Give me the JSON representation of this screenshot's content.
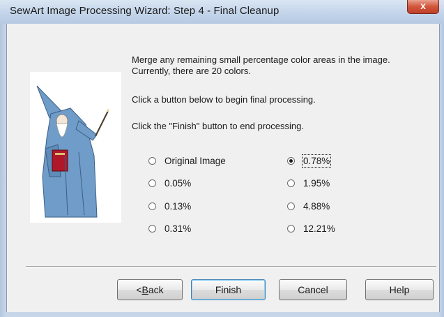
{
  "window": {
    "title": "SewArt Image Processing Wizard: Step 4 - Final Cleanup",
    "close_label": "x"
  },
  "instructions": {
    "line1": "Merge any remaining small percentage color  areas in the image. Currently, there are 20 colors.",
    "line2": "Click a button below to begin final processing.",
    "line3": "Click the \"Finish\" button to end processing."
  },
  "options": [
    {
      "label": "Original Image",
      "selected": false
    },
    {
      "label": "0.05%",
      "selected": false
    },
    {
      "label": "0.13%",
      "selected": false
    },
    {
      "label": "0.31%",
      "selected": false
    },
    {
      "label": "0.78%",
      "selected": true
    },
    {
      "label": "1.95%",
      "selected": false
    },
    {
      "label": "4.88%",
      "selected": false
    },
    {
      "label": "12.21%",
      "selected": false
    }
  ],
  "buttons": {
    "back_prefix": "< ",
    "back_mnemonic": "B",
    "back_rest": "ack",
    "finish": "Finish",
    "cancel": "Cancel",
    "help": "Help"
  },
  "colors": {
    "client_bg": "#f0f0f0",
    "wizard_robe": "#6f9cc8",
    "wizard_book": "#b0182a"
  }
}
